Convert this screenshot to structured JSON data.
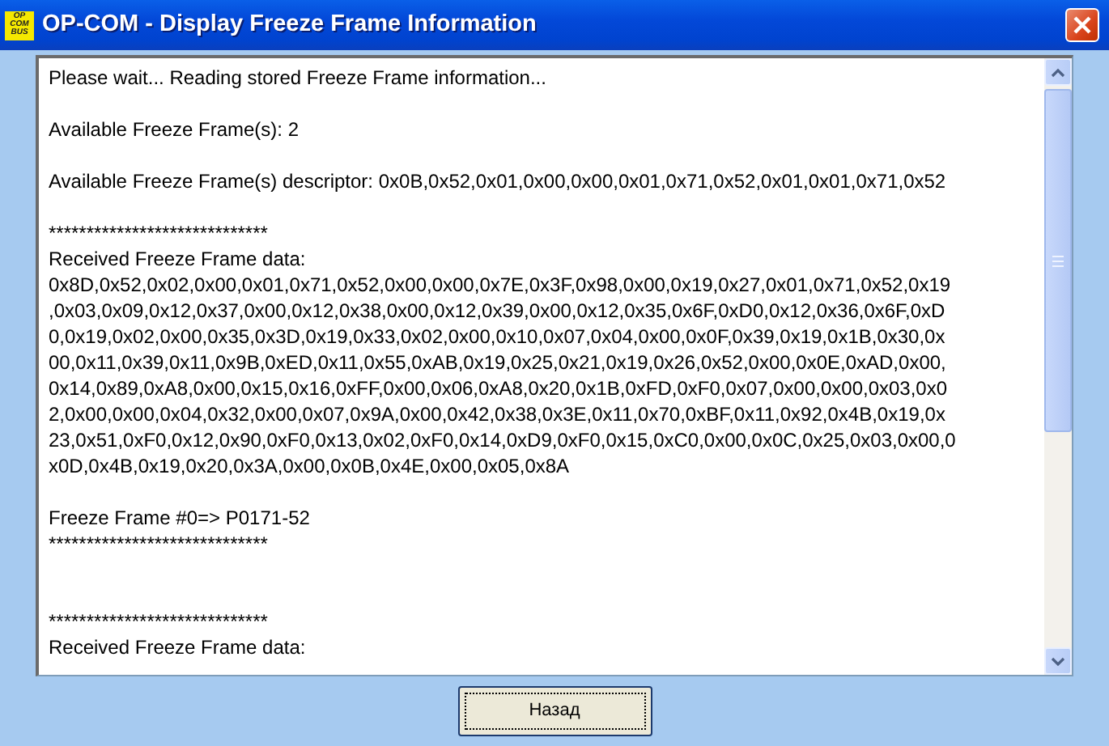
{
  "window": {
    "title": "OP-COM - Display Freeze Frame Information",
    "logo_lines": [
      "OP",
      "COM",
      "BUS"
    ]
  },
  "log": {
    "lines": [
      {
        "kind": "text",
        "text": "Please wait... Reading stored Freeze Frame information..."
      },
      {
        "kind": "blank"
      },
      {
        "kind": "text",
        "text": "Available Freeze Frame(s): 2"
      },
      {
        "kind": "blank"
      },
      {
        "kind": "text",
        "text": "Available Freeze Frame(s) descriptor: 0x0B,0x52,0x01,0x00,0x00,0x01,0x71,0x52,0x01,0x01,0x71,0x52"
      },
      {
        "kind": "blank"
      },
      {
        "kind": "text",
        "text": "*****************************"
      },
      {
        "kind": "text",
        "text": "Received Freeze Frame data:"
      },
      {
        "kind": "text",
        "text": "0x8D,0x52,0x02,0x00,0x01,0x71,0x52,0x00,0x00,0x7E,0x3F,0x98,0x00,0x19,0x27,0x01,0x71,0x52,0x19"
      },
      {
        "kind": "text",
        "text": ",0x03,0x09,0x12,0x37,0x00,0x12,0x38,0x00,0x12,0x39,0x00,0x12,0x35,0x6F,0xD0,0x12,0x36,0x6F,0xD"
      },
      {
        "kind": "text",
        "text": "0,0x19,0x02,0x00,0x35,0x3D,0x19,0x33,0x02,0x00,0x10,0x07,0x04,0x00,0x0F,0x39,0x19,0x1B,0x30,0x"
      },
      {
        "kind": "text",
        "text": "00,0x11,0x39,0x11,0x9B,0xED,0x11,0x55,0xAB,0x19,0x25,0x21,0x19,0x26,0x52,0x00,0x0E,0xAD,0x00,"
      },
      {
        "kind": "text",
        "text": "0x14,0x89,0xA8,0x00,0x15,0x16,0xFF,0x00,0x06,0xA8,0x20,0x1B,0xFD,0xF0,0x07,0x00,0x00,0x03,0x0"
      },
      {
        "kind": "text",
        "text": "2,0x00,0x00,0x04,0x32,0x00,0x07,0x9A,0x00,0x42,0x38,0x3E,0x11,0x70,0xBF,0x11,0x92,0x4B,0x19,0x"
      },
      {
        "kind": "text",
        "text": "23,0x51,0xF0,0x12,0x90,0xF0,0x13,0x02,0xF0,0x14,0xD9,0xF0,0x15,0xC0,0x00,0x0C,0x25,0x03,0x00,0"
      },
      {
        "kind": "text",
        "text": "x0D,0x4B,0x19,0x20,0x3A,0x00,0x0B,0x4E,0x00,0x05,0x8A"
      },
      {
        "kind": "blank"
      },
      {
        "kind": "text",
        "text": "Freeze Frame #0=> P0171-52"
      },
      {
        "kind": "text",
        "text": "*****************************"
      },
      {
        "kind": "blank"
      },
      {
        "kind": "blank"
      },
      {
        "kind": "text",
        "text": "*****************************"
      },
      {
        "kind": "text",
        "text": "Received Freeze Frame data:"
      }
    ]
  },
  "buttons": [
    {
      "label": "Назад"
    }
  ]
}
